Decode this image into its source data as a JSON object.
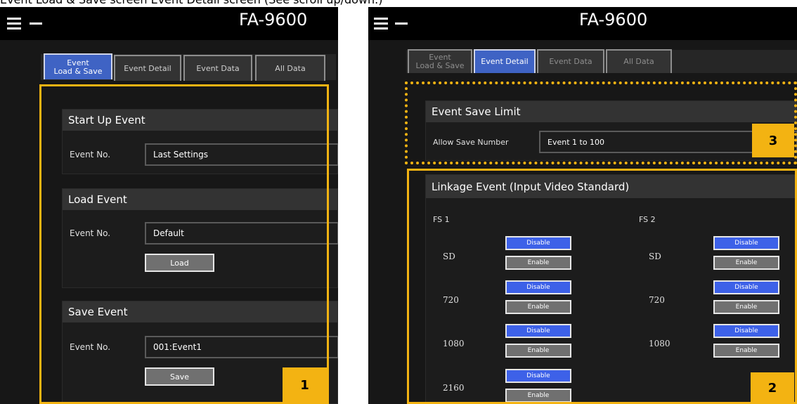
{
  "caption": "Event Load & Save screen Event Detail screen (See scroll up/down.)",
  "app_title": "FA-9600",
  "tabs": [
    {
      "label": "Event\nLoad & Save"
    },
    {
      "label": "Event Detail"
    },
    {
      "label": "Event Data"
    },
    {
      "label": "All Data"
    }
  ],
  "left": {
    "startup": {
      "title": "Start Up Event",
      "label": "Event No.",
      "value": "Last Settings"
    },
    "load": {
      "title": "Load Event",
      "label": "Event No.",
      "value": "Default",
      "button": "Load"
    },
    "save": {
      "title": "Save Event",
      "label": "Event No.",
      "value": "001:Event1",
      "button": "Save"
    },
    "badge": "1"
  },
  "right": {
    "save_limit": {
      "title": "Event Save Limit",
      "label": "Allow Save Number",
      "value": "Event 1 to 100"
    },
    "linkage": {
      "title": "Linkage Event (Input Video Standard)",
      "fs1": "FS 1",
      "fs2": "FS 2",
      "rows": [
        {
          "label": "SD",
          "disable": "Disable",
          "enable": "Enable"
        },
        {
          "label": "720",
          "disable": "Disable",
          "enable": "Enable"
        },
        {
          "label": "1080",
          "disable": "Disable",
          "enable": "Enable"
        },
        {
          "label": "2160",
          "disable": "Disable",
          "enable": "Enable"
        }
      ]
    },
    "badge_2": "2",
    "badge_3": "3"
  },
  "colors": {
    "accent": "#3f63c4",
    "callout": "#f3b312",
    "button_blue": "#3d61e8"
  }
}
